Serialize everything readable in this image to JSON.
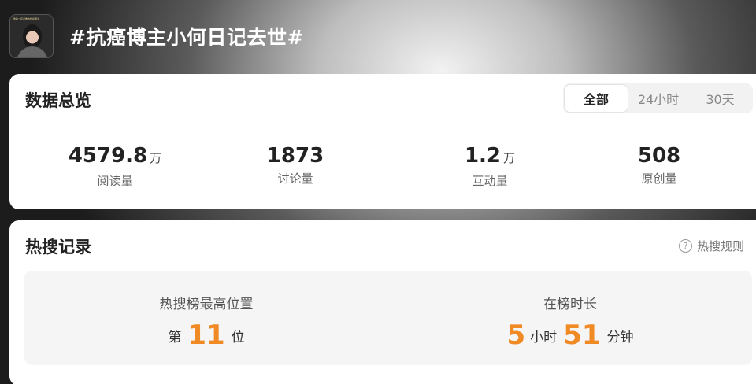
{
  "header": {
    "thumb_caption": "致敬一名勇敢的抗癌博主",
    "title": "#抗癌博主小何日记去世#"
  },
  "overview": {
    "title": "数据总览",
    "tabs": [
      "全部",
      "24小时",
      "30天"
    ],
    "active_tab": "全部",
    "stats": [
      {
        "value": "4579.8",
        "unit": "万",
        "label": "阅读量"
      },
      {
        "value": "1873",
        "unit": "",
        "label": "讨论量"
      },
      {
        "value": "1.2",
        "unit": "万",
        "label": "互动量"
      },
      {
        "value": "508",
        "unit": "",
        "label": "原创量"
      }
    ]
  },
  "hot_search": {
    "title": "热搜记录",
    "rules_label": "热搜规则",
    "peak": {
      "label": "热搜榜最高位置",
      "prefix": "第",
      "value": "11",
      "suffix": "位"
    },
    "duration": {
      "label": "在榜时长",
      "hours": "5",
      "hours_unit": "小时",
      "minutes": "51",
      "minutes_unit": "分钟"
    }
  },
  "colors": {
    "accent": "#f08a24",
    "card": "#ffffff",
    "panel": "#f5f5f5"
  }
}
